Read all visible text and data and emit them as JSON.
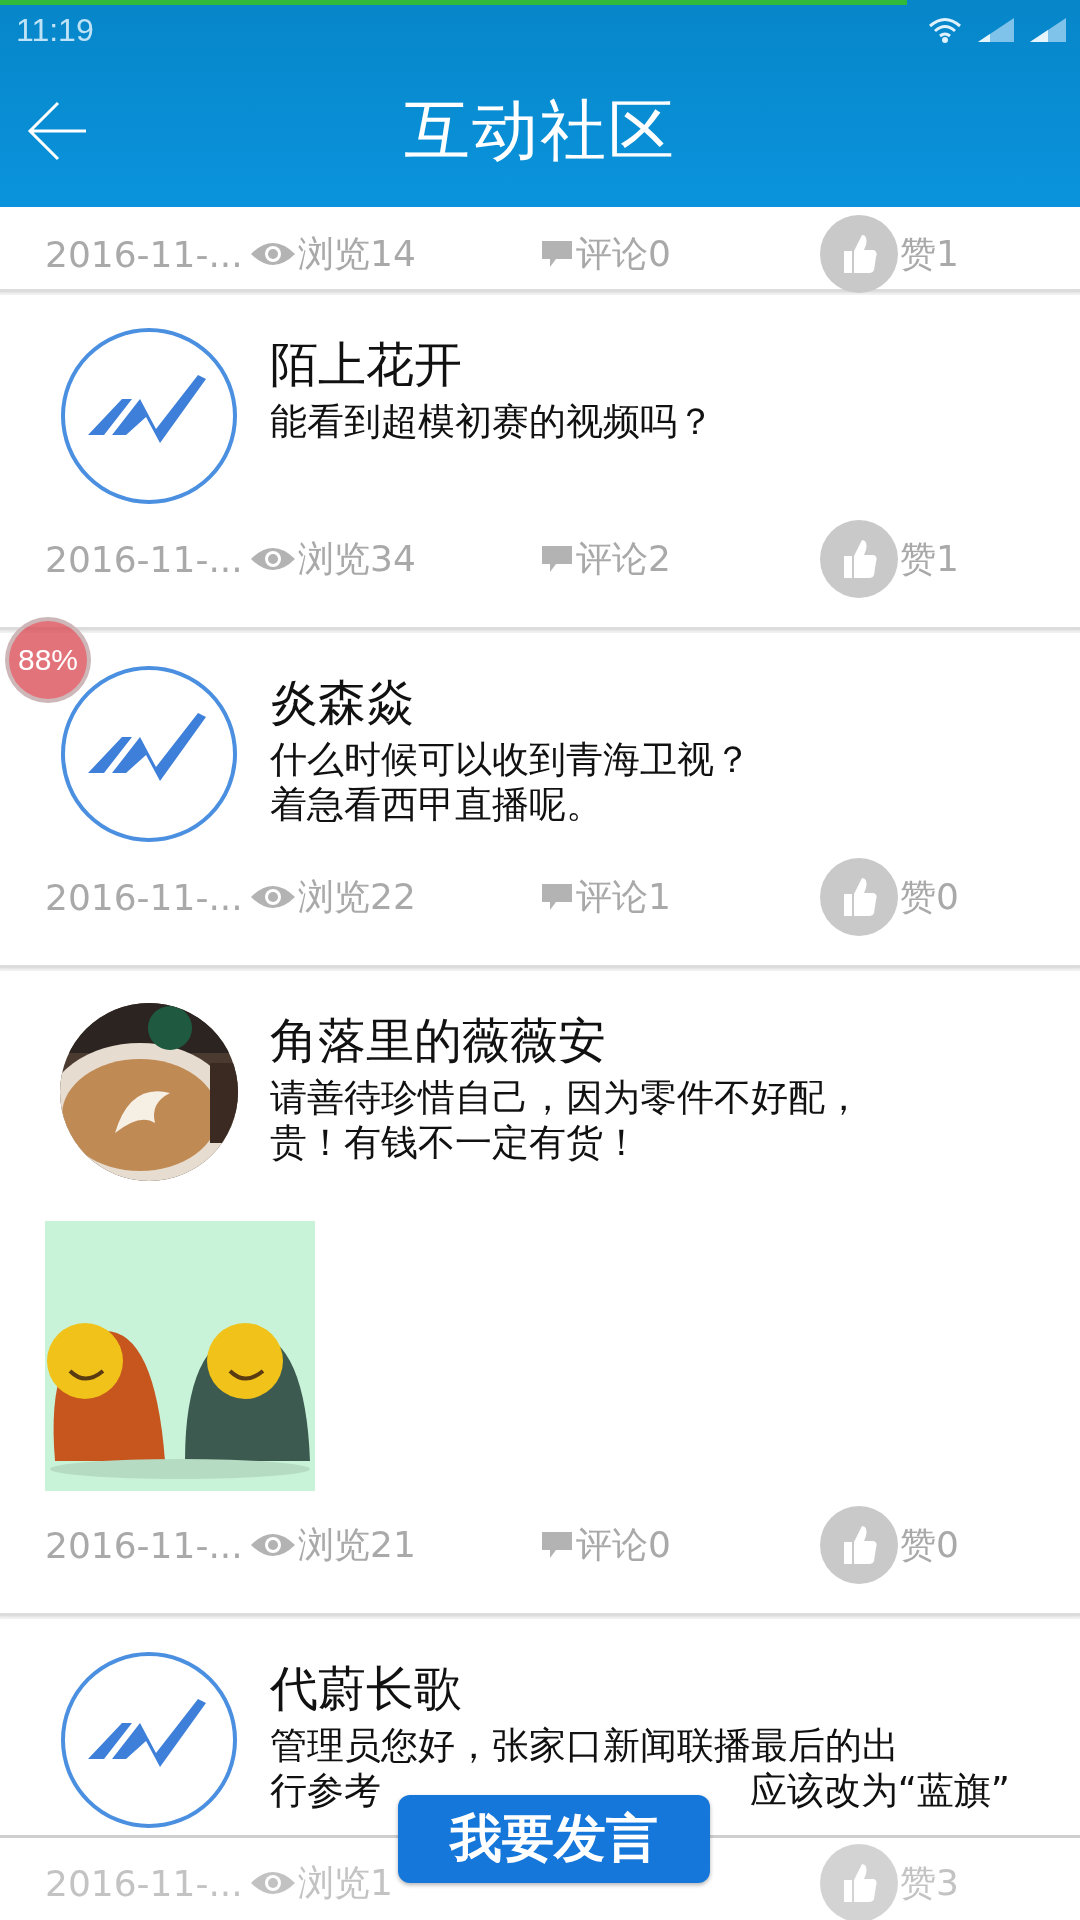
{
  "status_bar": {
    "time": "11:19"
  },
  "header": {
    "title": "互动社区"
  },
  "partial_post": {
    "date": "2016-11-...",
    "views": "浏览14",
    "comments": "评论0",
    "likes": "赞1"
  },
  "posts": [
    {
      "author": "陌上花开",
      "avatar": {
        "kind": "logo"
      },
      "lines": [
        [
          "能看到超模初赛的视频吗？"
        ]
      ],
      "image": false,
      "date": "2016-11-...",
      "views": "浏览34",
      "comments": "评论2",
      "likes": "赞1"
    },
    {
      "author": "炎森焱",
      "avatar": {
        "kind": "logo"
      },
      "lines": [
        [
          "什么时候可以收到青海卫视？"
        ],
        [
          "着急看西甲直播呢。"
        ]
      ],
      "image": false,
      "date": "2016-11-...",
      "views": "浏览22",
      "comments": "评论1",
      "likes": "赞0"
    },
    {
      "author": "角落里的薇薇安",
      "avatar": {
        "kind": "picture"
      },
      "lines": [
        [
          "请善待珍惜自己，因为零件不好配，"
        ],
        [
          "贵！有钱不一定有货！"
        ]
      ],
      "image": true,
      "date": "2016-11-...",
      "views": "浏览21",
      "comments": "评论0",
      "likes": "赞0"
    },
    {
      "author": "代蔚长歌",
      "avatar": {
        "kind": "logo"
      },
      "lines": [
        [
          "管理员您好，张家口新闻联播最后的出"
        ],
        [
          "行参考",
          "应该改为“蓝旗”"
        ]
      ],
      "image": false,
      "date": "2016-11-...",
      "views": "浏览1",
      "likes": "赞3"
    }
  ],
  "overlay_badge": "88%",
  "post_button": "我要发言"
}
